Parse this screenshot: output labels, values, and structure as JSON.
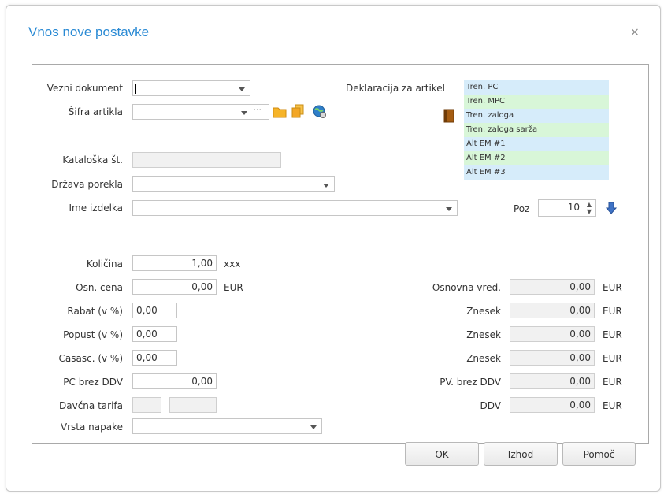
{
  "dialog": {
    "title": "Vnos nove postavke",
    "close": "×"
  },
  "form": {
    "vezni_dokument_label": "Vezni dokument",
    "sifra_artikla_label": "Šifra artikla",
    "sifra_ellipsis": "···",
    "deklaracija_label": "Deklaracija za artikel",
    "kataloska_label": "Kataloška št.",
    "drzava_label": "Država porekla",
    "ime_label": "Ime izdelka",
    "poz_label": "Poz",
    "poz_value": "10",
    "kolicina_label": "Količina",
    "kolicina_value": "1,00",
    "kolicina_unit": "xxx",
    "osn_cena_label": "Osn. cena",
    "osn_cena_value": "0,00",
    "osn_cena_unit": "EUR",
    "rabat_label": "Rabat (v %)",
    "rabat_value": "0,00",
    "popust_label": "Popust (v %)",
    "popust_value": "0,00",
    "casasc_label": "Casasc. (v %)",
    "casasc_value": "0,00",
    "pc_brez_ddv_label": "PC brez DDV",
    "pc_brez_ddv_value": "0,00",
    "davcna_label": "Davčna tarifa",
    "vrsta_label": "Vrsta napake",
    "right": [
      {
        "label": "Osnovna vred.",
        "value": "0,00",
        "unit": "EUR"
      },
      {
        "label": "Znesek",
        "value": "0,00",
        "unit": "EUR"
      },
      {
        "label": "Znesek",
        "value": "0,00",
        "unit": "EUR"
      },
      {
        "label": "Znesek",
        "value": "0,00",
        "unit": "EUR"
      },
      {
        "label": "PV. brez DDV",
        "value": "0,00",
        "unit": "EUR"
      },
      {
        "label": "DDV",
        "value": "0,00",
        "unit": "EUR"
      }
    ]
  },
  "declaration": [
    {
      "text": "Tren. PC",
      "style": "a"
    },
    {
      "text": "Tren. MPC",
      "style": "b"
    },
    {
      "text": "Tren. zaloga",
      "style": "a"
    },
    {
      "text": "Tren. zaloga sarža",
      "style": "b"
    },
    {
      "text": "Alt EM #1",
      "style": "a"
    },
    {
      "text": "Alt EM #2",
      "style": "b"
    },
    {
      "text": "Alt EM #3",
      "style": "a"
    }
  ],
  "buttons": {
    "ok": "OK",
    "izhod": "Izhod",
    "pomoc": "Pomoč"
  },
  "colors": {
    "title": "#2a8ad4",
    "decl_blue": "#d6ecfa",
    "decl_green": "#d8f6d8"
  }
}
